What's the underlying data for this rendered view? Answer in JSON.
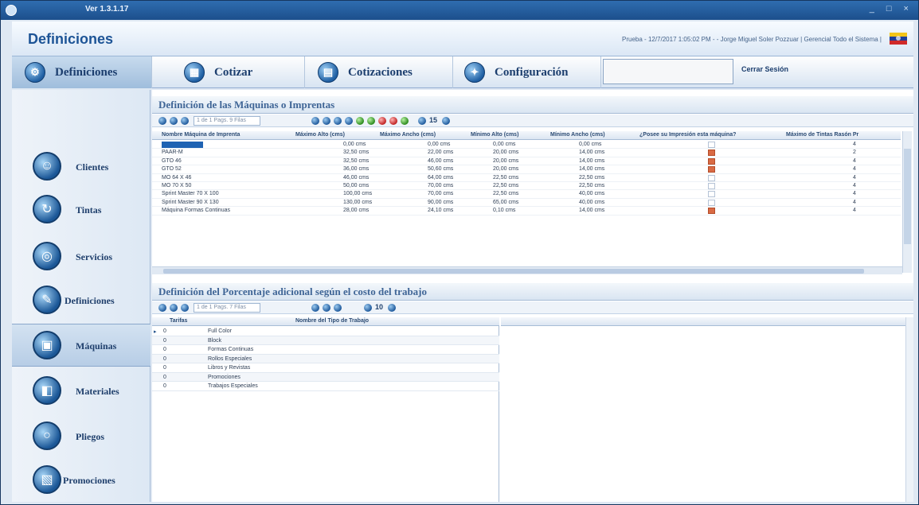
{
  "window": {
    "version": "Ver 1.3.1.17",
    "controls": "_ □ ×"
  },
  "header": {
    "title": "Definiciones",
    "user_info": "Prueba - 12/7/2017 1:05:02 PM - - Jorge Miguel Soler Pozzuar | Gerencial Todo el Sistema |"
  },
  "nav": {
    "tabs": [
      {
        "label": "Definiciones",
        "icon": "gear-icon"
      },
      {
        "label": "Cotizar",
        "icon": "calculator-icon"
      },
      {
        "label": "Cotizaciones",
        "icon": "documents-icon"
      },
      {
        "label": "Configuración",
        "icon": "settings-icon"
      }
    ],
    "logout": "Cerrar Sesión"
  },
  "sidebar": {
    "items": [
      {
        "label": "Clientes",
        "icon": "clients-icon"
      },
      {
        "label": "Tintas",
        "icon": "ink-icon"
      },
      {
        "label": "Servicios",
        "icon": "services-icon"
      },
      {
        "label": "Definiciones",
        "icon": "definitions-icon"
      },
      {
        "label": "Máquinas",
        "icon": "machine-icon"
      },
      {
        "label": "Materiales",
        "icon": "materials-icon"
      },
      {
        "label": "Pliegos",
        "icon": "sheets-icon"
      },
      {
        "label": "Promociones",
        "icon": "promotions-icon"
      }
    ]
  },
  "machines": {
    "title": "Definición de las Máquinas o Imprentas",
    "page_field": "1 de 1 Pags. 9 Filas",
    "page_size": "15",
    "columns": [
      "Nombre Máquina de Imprenta",
      "Máximo Alto (cms)",
      "Máximo Ancho (cms)",
      "Mínimo Alto (cms)",
      "Mínimo Ancho (cms)",
      "¿Posee su Impresión esta máquina?",
      "Máximo de Tintas Rasón Pr"
    ],
    "rows": [
      {
        "name": "",
        "max_alto": "0,00 cms",
        "max_ancho": "0,00 cms",
        "min_alto": "0,00 cms",
        "min_ancho": "0,00 cms",
        "checked": false,
        "tintas": "4"
      },
      {
        "name": "PAAR-M",
        "max_alto": "32,50 cms",
        "max_ancho": "22,00 cms",
        "min_alto": "20,00 cms",
        "min_ancho": "14,00 cms",
        "checked": true,
        "tintas": "2"
      },
      {
        "name": "GTO 46",
        "max_alto": "32,50 cms",
        "max_ancho": "46,00 cms",
        "min_alto": "20,00 cms",
        "min_ancho": "14,00 cms",
        "checked": true,
        "tintas": "4"
      },
      {
        "name": "GTO 52",
        "max_alto": "36,00 cms",
        "max_ancho": "50,60 cms",
        "min_alto": "20,00 cms",
        "min_ancho": "14,00 cms",
        "checked": true,
        "tintas": "4"
      },
      {
        "name": "MO 64 X 46",
        "max_alto": "46,00 cms",
        "max_ancho": "64,00 cms",
        "min_alto": "22,50 cms",
        "min_ancho": "22,50 cms",
        "checked": false,
        "tintas": "4"
      },
      {
        "name": "MO 70 X 50",
        "max_alto": "50,00 cms",
        "max_ancho": "70,00 cms",
        "min_alto": "22,50 cms",
        "min_ancho": "22,50 cms",
        "checked": false,
        "tintas": "4"
      },
      {
        "name": "Sprint Master 70 X 100",
        "max_alto": "100,00 cms",
        "max_ancho": "70,00 cms",
        "min_alto": "22,50 cms",
        "min_ancho": "40,00 cms",
        "checked": false,
        "tintas": "4"
      },
      {
        "name": "Sprint Master 90 X 130",
        "max_alto": "130,00 cms",
        "max_ancho": "90,00 cms",
        "min_alto": "65,00 cms",
        "min_ancho": "40,00 cms",
        "checked": false,
        "tintas": "4"
      },
      {
        "name": "Máquina Formas Continuas",
        "max_alto": "28,00 cms",
        "max_ancho": "24,10 cms",
        "min_alto": "0,10 cms",
        "min_ancho": "14,00 cms",
        "checked": true,
        "tintas": "4"
      }
    ]
  },
  "percentage": {
    "title": "Definición del Porcentaje adicional según el costo del trabajo",
    "page_field": "1 de 1 Pags. 7 Filas",
    "page_size": "10",
    "columns": [
      "Tarifas",
      "Nombre del Tipo de Trabajo"
    ],
    "rows": [
      {
        "tarifa": "0",
        "nombre": "Full Color"
      },
      {
        "tarifa": "0",
        "nombre": "Block"
      },
      {
        "tarifa": "0",
        "nombre": "Formas Continuas"
      },
      {
        "tarifa": "0",
        "nombre": "Rollos Especiales"
      },
      {
        "tarifa": "0",
        "nombre": "Libros y Revistas"
      },
      {
        "tarifa": "0",
        "nombre": "Promociones"
      },
      {
        "tarifa": "0",
        "nombre": "Trabajos Especiales"
      }
    ]
  }
}
